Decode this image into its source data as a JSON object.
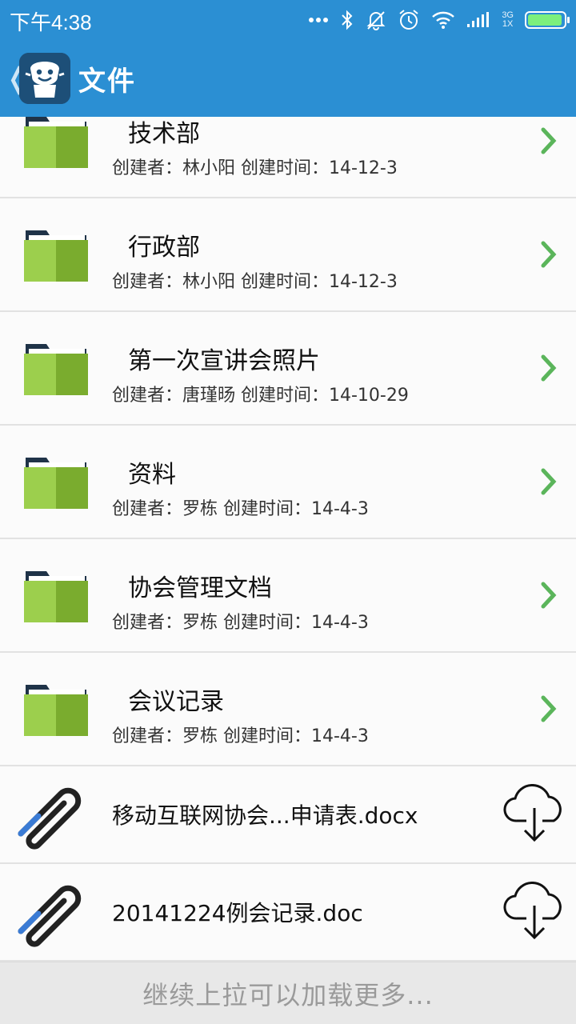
{
  "status_bar": {
    "time": "下午4:38",
    "network_top": "3G",
    "network_bottom": "1X",
    "battery_level": 0.95,
    "icons": [
      "more-dots-icon",
      "bluetooth-icon",
      "mute-icon",
      "alarm-icon",
      "wifi-icon",
      "signal-icon",
      "battery-icon"
    ]
  },
  "header": {
    "back_glyph": "❬",
    "title": "文件"
  },
  "folders": [
    {
      "name": "技术部",
      "meta": "创建者：林小阳 创建时间：14-12-3"
    },
    {
      "name": "行政部",
      "meta": "创建者：林小阳 创建时间：14-12-3"
    },
    {
      "name": "第一次宣讲会照片",
      "meta": "创建者：唐瑾旸 创建时间：14-10-29"
    },
    {
      "name": "资料",
      "meta": "创建者：罗栋 创建时间：14-4-3"
    },
    {
      "name": "协会管理文档",
      "meta": "创建者：罗栋 创建时间：14-4-3"
    },
    {
      "name": "会议记录",
      "meta": "创建者：罗栋 创建时间：14-4-3"
    }
  ],
  "files": [
    {
      "name": "移动互联网协会...申请表.docx"
    },
    {
      "name": "20141224例会记录.doc"
    }
  ],
  "footer": {
    "load_more": "继续上拉可以加载更多..."
  },
  "colors": {
    "primary": "#2b8fd3",
    "folder_light": "#9ccf4d",
    "folder_dark": "#7aac2e",
    "chevron": "#5bb55b"
  }
}
